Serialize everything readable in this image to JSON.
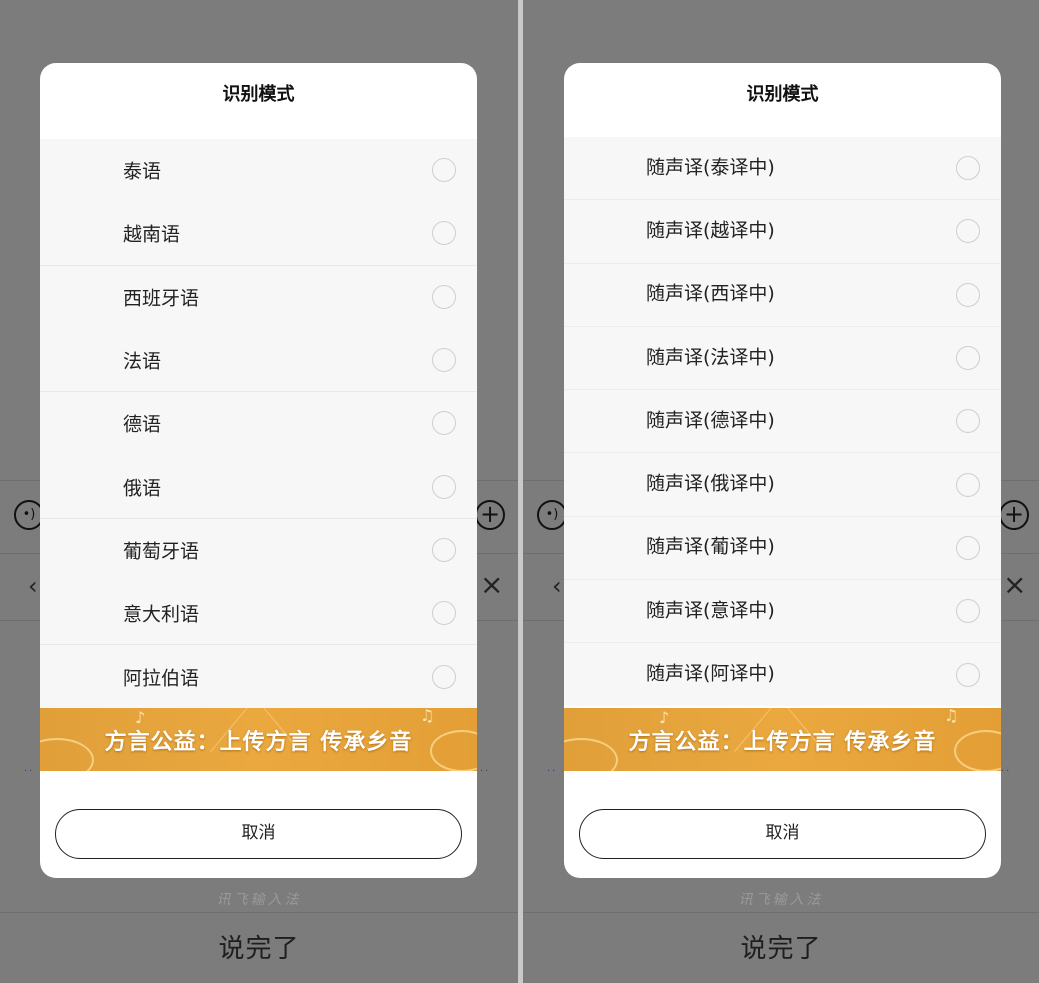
{
  "left_panel": {
    "dialog": {
      "title": "识别模式",
      "options": [
        {
          "label": "泰语"
        },
        {
          "label": "越南语"
        },
        {
          "label": "西班牙语"
        },
        {
          "label": "法语"
        },
        {
          "label": "德语"
        },
        {
          "label": "俄语"
        },
        {
          "label": "葡萄牙语"
        },
        {
          "label": "意大利语"
        },
        {
          "label": "阿拉伯语"
        }
      ],
      "banner_text": "方言公益：上传方言 传承乡音",
      "cancel_label": "取消"
    },
    "keyboard": {
      "ime_name": "讯飞输入法",
      "done_label": "说完了"
    }
  },
  "right_panel": {
    "dialog": {
      "title": "识别模式",
      "options": [
        {
          "label": "随声译(泰译中)"
        },
        {
          "label": "随声译(越译中)"
        },
        {
          "label": "随声译(西译中)"
        },
        {
          "label": "随声译(法译中)"
        },
        {
          "label": "随声译(德译中)"
        },
        {
          "label": "随声译(俄译中)"
        },
        {
          "label": "随声译(葡译中)"
        },
        {
          "label": "随声译(意译中)"
        },
        {
          "label": "随声译(阿译中)"
        }
      ],
      "banner_text": "方言公益：上传方言 传承乡音",
      "cancel_label": "取消"
    },
    "keyboard": {
      "ime_name": "讯飞输入法",
      "done_label": "说完了"
    }
  },
  "icons": {
    "voice": "voice-wave-icon",
    "plus": "plus-circle-icon",
    "back": "chevron-left-icon",
    "close": "close-icon",
    "radio": "radio-unselected-icon"
  },
  "colors": {
    "overlay": "#7b7b7b",
    "banner": "#e8a53d",
    "dialog_bg": "#ffffff",
    "list_bg": "#f7f7f7"
  }
}
